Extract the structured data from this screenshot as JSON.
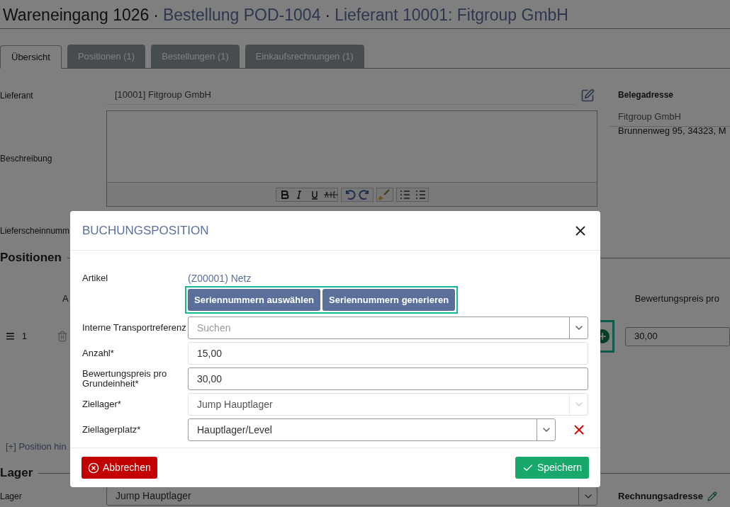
{
  "title": {
    "main": "Wareneingang 1026",
    "separator": "·",
    "links": [
      "Bestellung POD-1004",
      "Lieferant 10001: Fitgroup GmbH"
    ]
  },
  "tabs": [
    {
      "label": "Übersicht",
      "selected": true
    },
    {
      "label": "Positionen (1)",
      "selected": false
    },
    {
      "label": "Bestellungen (1)",
      "selected": false
    },
    {
      "label": "Einkaufsrechnungen (1)",
      "selected": false
    }
  ],
  "form": {
    "supplier_label": "Lieferant",
    "supplier_value": "[10001] Fitgroup GmbH",
    "description_label": "Beschreibung",
    "delivery_note_label": "Lieferscheinnumm"
  },
  "document_address": {
    "heading": "Belegadresse",
    "name": "Fitgroup GmbH",
    "street": "Brunnenweg 95, 34323, M"
  },
  "positions": {
    "heading": "Positionen",
    "column_1": "A",
    "column_2": "Bewertungspreis pro",
    "row": {
      "menu": "≡",
      "number": "1",
      "add_highlighted": true,
      "price": "30,00"
    },
    "add_link": "[+] Position hin"
  },
  "storage": {
    "heading": "Lager",
    "label": "Lager",
    "value": "Jump Hauptlager",
    "invoice_address": "Rechnungsadresse"
  },
  "dialog": {
    "title": "BUCHUNGSPOSITION",
    "article_label": "Artikel",
    "article": "(Z00001) Netz",
    "serial_buttons": [
      "Seriennummern auswählen",
      "Seriennummern generieren"
    ],
    "serial_highlighted": true,
    "fields": [
      {
        "kind": "select",
        "label": "Interne Transportreferenz",
        "placeholder": "Suchen",
        "disabled": false
      },
      {
        "kind": "input",
        "label": "Anzahl*",
        "value": "15,00",
        "disabled": true
      },
      {
        "kind": "input",
        "label": "Bewertungspreis pro Grundeinheit*",
        "value": "30,00",
        "disabled": false
      },
      {
        "kind": "select",
        "label": "Ziellager*",
        "value": "Jump Hauptlager",
        "disabled": true
      },
      {
        "kind": "clearable",
        "label": "Ziellagerplatz*",
        "value": "Hauptlager/Level",
        "disabled": false
      }
    ],
    "cancel": "Abbrechen",
    "save": "Speichern"
  }
}
